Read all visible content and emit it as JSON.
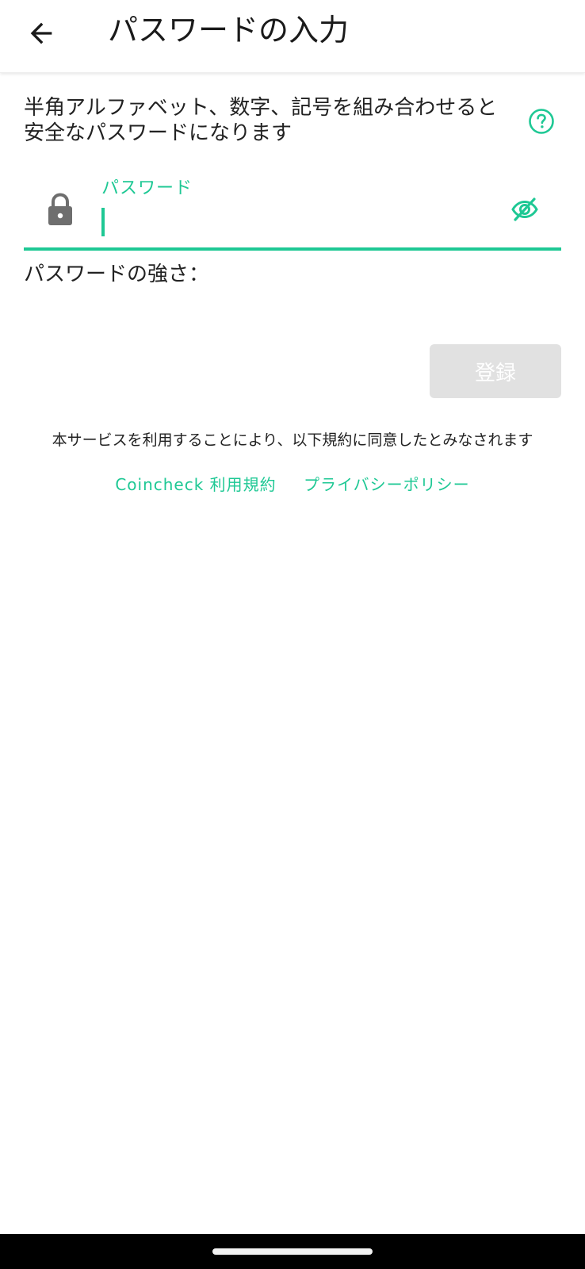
{
  "header": {
    "title": "パスワードの入力",
    "back_icon": "arrow-left-icon"
  },
  "hint": {
    "text": "半角アルファベット、数字、記号を組み合わせると安全なパスワードになります",
    "help_icon": "question-circle-icon"
  },
  "password_field": {
    "label": "パスワード",
    "value": "",
    "lead_icon": "lock-icon",
    "toggle_icon": "eye-off-icon"
  },
  "strength": {
    "label": "パスワードの強さ："
  },
  "register_button": {
    "label": "登録"
  },
  "terms": {
    "note": "本サービスを利用することにより、以下規約に同意したとみなされます",
    "links": [
      "Coincheck 利用規約",
      "プライバシーポリシー"
    ]
  },
  "colors": {
    "accent": "#1ec894",
    "disabled_button": "#e1e1e1",
    "icon_gray": "#6e6e6e"
  }
}
